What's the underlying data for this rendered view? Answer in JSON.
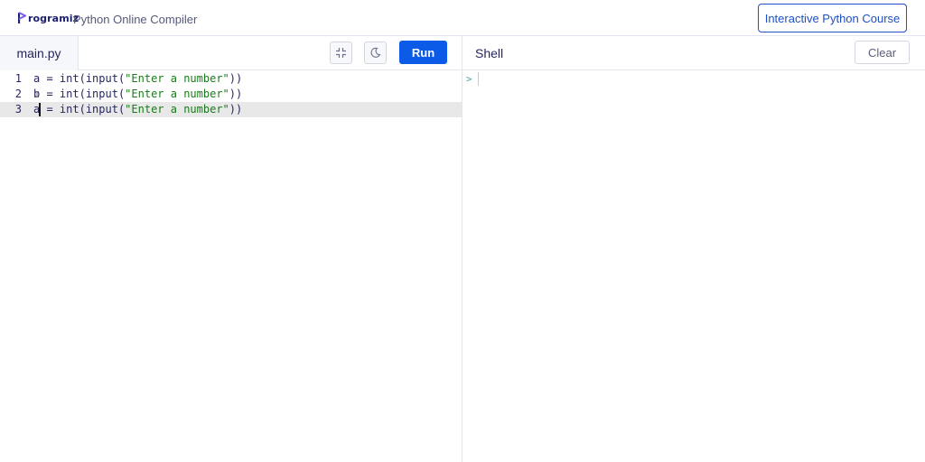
{
  "header": {
    "logo_text": "rogramiz",
    "logo_lettering": "Programiz",
    "app_title": "Python Online Compiler",
    "course_button": "Interactive Python Course"
  },
  "editor": {
    "file_tab": "main.py",
    "run_label": "Run",
    "active_line": 3,
    "lines": [
      {
        "number": "1",
        "var": "a",
        "op": " = ",
        "fn": "int(input(",
        "str": "\"Enter a number\"",
        "close": "))"
      },
      {
        "number": "2",
        "var": "b",
        "op": " = ",
        "fn": "int(input(",
        "str": "\"Enter a number\"",
        "close": "))"
      },
      {
        "number": "3",
        "var": "a",
        "op": " = ",
        "fn": "int(input(",
        "str": "\"Enter a number\"",
        "close": "))"
      }
    ],
    "icons": {
      "fullscreen": "collapse-icon",
      "theme": "moon-icon"
    }
  },
  "shell": {
    "title": "Shell",
    "clear_label": "Clear",
    "prompt": ">"
  },
  "colors": {
    "accent": "#0b5ae8",
    "string": "#1a7a1a",
    "text": "#25265e",
    "active_line": "#e8e8e8"
  }
}
